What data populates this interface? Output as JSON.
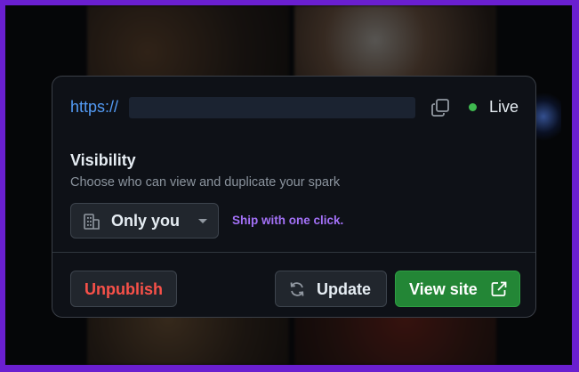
{
  "url": {
    "prefix": "https://"
  },
  "status": {
    "label": "Live",
    "color": "#3fb950"
  },
  "visibility": {
    "title": "Visibility",
    "description": "Choose who can view and duplicate your spark",
    "selected": "Only you",
    "select_icon": "building-icon"
  },
  "promo": {
    "text": "Ship with one click."
  },
  "actions": {
    "unpublish_label": "Unpublish",
    "update_label": "Update",
    "view_site_label": "View site"
  },
  "colors": {
    "accent_link": "#539bf5",
    "danger": "#f85149",
    "primary": "#238636",
    "promo": "#a371f7"
  }
}
